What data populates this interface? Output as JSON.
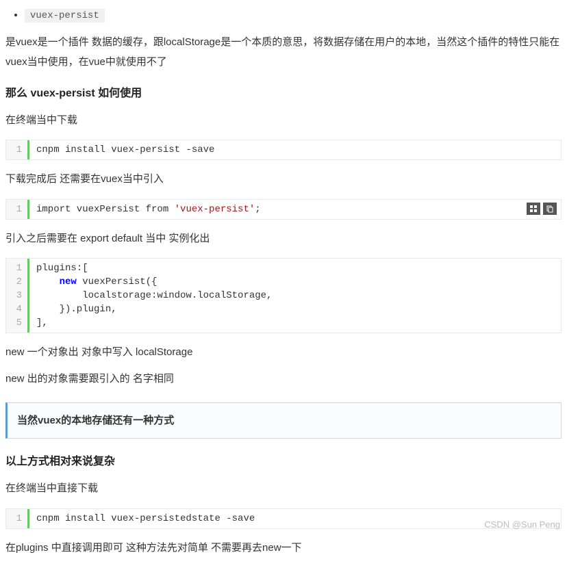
{
  "list_item": "vuex-persist",
  "intro": "是vuex是一个插件 数据的缓存，跟localStorage是一个本质的意思，将数据存储在用户的本地，当然这个插件的特性只能在vuex当中使用，在vue中就使用不了",
  "h1": "那么 vuex-persist 如何使用",
  "p1": "在终端当中下载",
  "code1": {
    "lines": [
      "1"
    ],
    "text": "cnpm install vuex-persist -save"
  },
  "p2": "下载完成后 还需要在vuex当中引入",
  "code2": {
    "lines": [
      "1"
    ],
    "prefix": "import vuexPersist from ",
    "str": "'vuex-persist'",
    "suffix": ";"
  },
  "p3": "引入之后需要在 export default 当中 实例化出",
  "code3": {
    "lines": [
      "1",
      "2",
      "3",
      "4",
      "5"
    ],
    "l1": "plugins:[",
    "l2_pre": "    ",
    "l2_kw": "new",
    "l2_post": " vuexPersist({",
    "l3": "        localstorage:window.localStorage,",
    "l4": "    }).plugin,",
    "l5": "],"
  },
  "p4": "new 一个对象出 对象中写入 localStorage",
  "p5": "new 出的对象需要跟引入的 名字相同",
  "quote": "当然vuex的本地存储还有一种方式",
  "h2": "以上方式相对来说复杂",
  "p6": "在终端当中直接下载",
  "code4": {
    "lines": [
      "1"
    ],
    "text": "cnpm install vuex-persistedstate -save"
  },
  "p7": "在plugins 中直接调用即可 这种方法先对简单 不需要再去new一下",
  "watermark": "CSDN @Sun Peng"
}
